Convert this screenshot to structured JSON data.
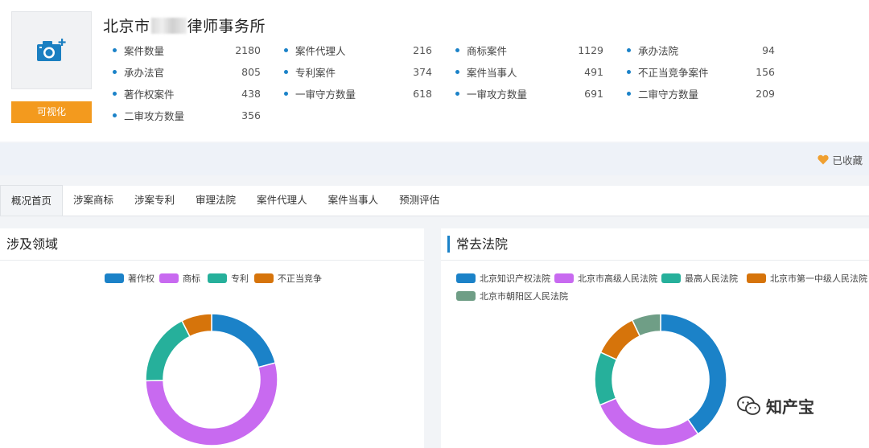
{
  "firm": {
    "title_prefix": "北京市",
    "title_suffix": "律师事务所"
  },
  "visualize_button": "可视化",
  "stats": [
    {
      "label": "案件数量",
      "value": "2180"
    },
    {
      "label": "案件代理人",
      "value": "216"
    },
    {
      "label": "商标案件",
      "value": "1129"
    },
    {
      "label": "承办法院",
      "value": "94"
    },
    {
      "label": "承办法官",
      "value": "805"
    },
    {
      "label": "专利案件",
      "value": "374"
    },
    {
      "label": "案件当事人",
      "value": "491"
    },
    {
      "label": "不正当竞争案件",
      "value": "156"
    },
    {
      "label": "著作权案件",
      "value": "438"
    },
    {
      "label": "一审守方数量",
      "value": "618"
    },
    {
      "label": "一审攻方数量",
      "value": "691"
    },
    {
      "label": "二审守方数量",
      "value": "209"
    },
    {
      "label": "二审攻方数量",
      "value": "356"
    }
  ],
  "favorite_label": "已收藏",
  "tabs": [
    "概况首页",
    "涉案商标",
    "涉案专利",
    "审理法院",
    "案件代理人",
    "案件当事人",
    "预测评估"
  ],
  "active_tab": 0,
  "panels": {
    "left_title": "涉及领域",
    "right_title": "常去法院"
  },
  "colors": {
    "accent_blue": "#1b82c8",
    "button_orange": "#f39a1e"
  },
  "chart_data": [
    {
      "type": "pie",
      "legend_placement": "top",
      "categories": [
        "著作权",
        "商标",
        "专利",
        "不正当竞争"
      ],
      "values": [
        438,
        1129,
        374,
        156
      ],
      "colors": [
        "#1b82c8",
        "#c86af0",
        "#26b09b",
        "#d6740b"
      ]
    },
    {
      "type": "pie",
      "legend_placement": "top",
      "categories": [
        "北京知识产权法院",
        "北京市高级人民法院",
        "最高人民法院",
        "北京市第一中级人民法院",
        "北京市朝阳区人民法院"
      ],
      "values": [
        40,
        28,
        13,
        11,
        7
      ],
      "colors": [
        "#1b82c8",
        "#c86af0",
        "#26b09b",
        "#d6740b",
        "#6f9e86"
      ]
    }
  ],
  "watermark": "知产宝"
}
